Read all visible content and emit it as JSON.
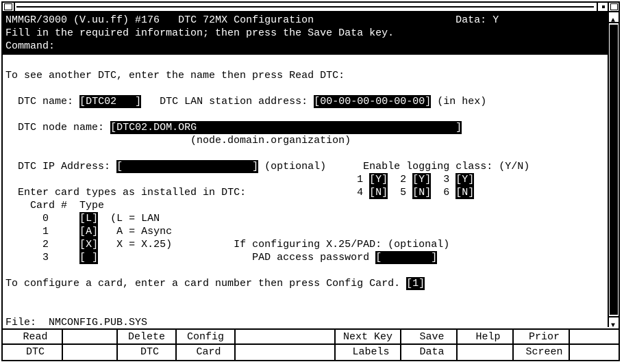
{
  "header": {
    "program": "NMMGR/3000 (V.uu.ff) #176",
    "title": "DTC 72MX Configuration",
    "data_flag_label": "Data:",
    "data_flag": "Y",
    "hint": "Fill in the required information; then press the Save Data key.",
    "command_label": "Command:"
  },
  "instructions": {
    "read_dtc": "To see another DTC, enter the name then press Read DTC:"
  },
  "dtc": {
    "name_label": "DTC name:",
    "name": "DTC02   ",
    "lan_label": "DTC LAN station address:",
    "lan": "00-00-00-00-00-00",
    "lan_note": "(in hex)",
    "node_label": "DTC node name:",
    "node": "DTC02.DOM.ORG                                          ",
    "node_note": "(node.domain.organization)",
    "ip_label": "DTC IP Address:",
    "ip": "                     ",
    "ip_note": "(optional)"
  },
  "logging": {
    "label": "Enable logging class: (Y/N)",
    "c1": "Y",
    "c2": "Y",
    "c3": "Y",
    "c4": "N",
    "c5": "N",
    "c6": "N"
  },
  "cards": {
    "prompt": "Enter card types as installed in DTC:",
    "header": "Card #  Type",
    "rows": [
      {
        "num": "0",
        "type": "L",
        "legend": "(L = LAN"
      },
      {
        "num": "1",
        "type": "A",
        "legend": " A = Async"
      },
      {
        "num": "2",
        "type": "X",
        "legend": " X = X.25)"
      },
      {
        "num": "3",
        "type": " "
      }
    ]
  },
  "x25": {
    "note": "If configuring X.25/PAD: (optional)",
    "pwd_label": "PAD access password",
    "pwd": "        "
  },
  "config": {
    "prompt": "To configure a card, enter a card number then press Config Card.",
    "card": "1"
  },
  "file": {
    "label": "File:",
    "name": "NMCONFIG.PUB.SYS"
  },
  "softkeys": {
    "f1a": " Read",
    "f1b": " DTC",
    "f2a": "",
    "f2b": "",
    "f3a": "Delete",
    "f3b": " DTC",
    "f4a": "Config",
    "f4b": " Card",
    "f5a": "",
    "f5b": "",
    "f6a": "Next Key",
    "f6b": " Labels",
    "f7a": " Save",
    "f7b": " Data",
    "f8a": " Help",
    "f8b": "",
    "f9a": " Prior",
    "f9b": " Screen"
  }
}
